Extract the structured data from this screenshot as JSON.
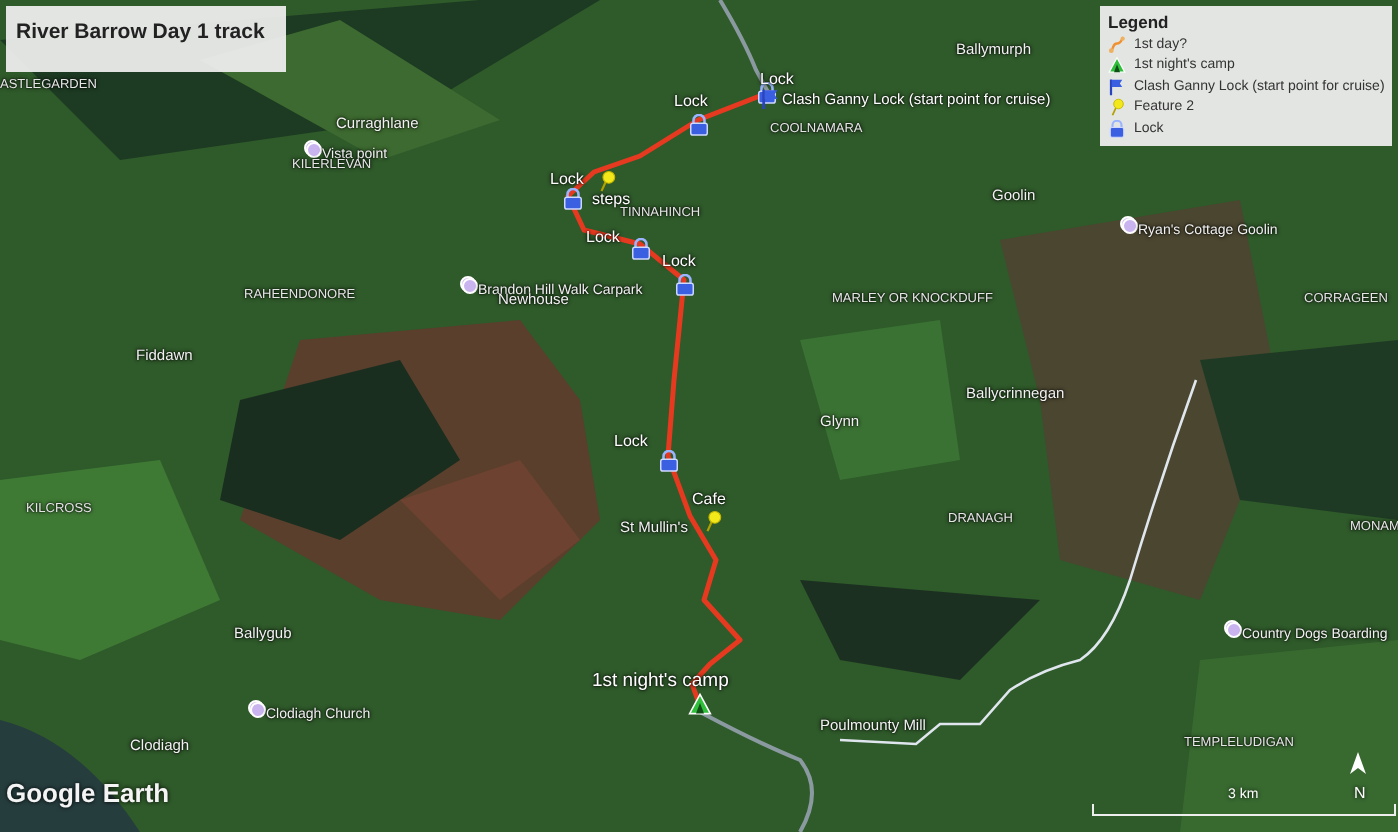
{
  "title": "River Barrow Day 1 track",
  "legend": {
    "heading": "Legend",
    "items": [
      {
        "kind": "route",
        "label": "1st day?"
      },
      {
        "kind": "camp",
        "label": "1st night's camp"
      },
      {
        "kind": "start",
        "label": "Clash Ganny Lock (start point for cruise)"
      },
      {
        "kind": "feature",
        "label": "Feature 2"
      },
      {
        "kind": "lock",
        "label": "Lock"
      }
    ]
  },
  "markers": [
    {
      "kind": "lock",
      "label": "Lock"
    },
    {
      "kind": "lock",
      "label": "Lock"
    },
    {
      "kind": "start",
      "label": "Clash Ganny Lock (start point for cruise)"
    },
    {
      "kind": "feature",
      "label": "steps"
    },
    {
      "kind": "lock",
      "label": "Lock"
    },
    {
      "kind": "lock",
      "label": "Lock"
    },
    {
      "kind": "lock",
      "label": "Lock"
    },
    {
      "kind": "lock",
      "label": "Lock"
    },
    {
      "kind": "feature",
      "label": "Cafe"
    },
    {
      "kind": "camp",
      "label": "1st night's camp"
    }
  ],
  "places": [
    {
      "kind": "area",
      "text": "ASTLEGARDEN"
    },
    {
      "kind": "town",
      "text": "Curraghlane"
    },
    {
      "kind": "poi",
      "text": "Vista point"
    },
    {
      "kind": "area",
      "text": "KILERLEVAN"
    },
    {
      "kind": "area",
      "text": "TINNAHINCH"
    },
    {
      "kind": "area",
      "text": "COOLNAMARA"
    },
    {
      "kind": "town",
      "text": "Ballymurph"
    },
    {
      "kind": "town",
      "text": "Goolin"
    },
    {
      "kind": "poi",
      "text": "Ryan's Cottage Goolin"
    },
    {
      "kind": "poi",
      "text": "Brandon Hill Walk Carpark"
    },
    {
      "kind": "town",
      "text": "Newhouse"
    },
    {
      "kind": "area",
      "text": "RAHEENDONORE"
    },
    {
      "kind": "area",
      "text": "MARLEY OR KNOCKDUFF"
    },
    {
      "kind": "area",
      "text": "CORRAGEEN"
    },
    {
      "kind": "town",
      "text": "Fiddawn"
    },
    {
      "kind": "town",
      "text": "Glynn"
    },
    {
      "kind": "town",
      "text": "Ballycrinnegan"
    },
    {
      "kind": "area",
      "text": "KILCROSS"
    },
    {
      "kind": "town",
      "text": "St Mullin's"
    },
    {
      "kind": "area",
      "text": "DRANAGH"
    },
    {
      "kind": "area",
      "text": "MONAM"
    },
    {
      "kind": "town",
      "text": "Ballygub"
    },
    {
      "kind": "poi",
      "text": "Clodiagh Church"
    },
    {
      "kind": "town",
      "text": "Clodiagh"
    },
    {
      "kind": "town",
      "text": "Poulmounty Mill"
    },
    {
      "kind": "poi",
      "text": "Country Dogs Boarding"
    },
    {
      "kind": "area",
      "text": "TEMPLELUDIGAN"
    }
  ],
  "scale": {
    "label": "3 km"
  },
  "compass": {
    "label": "N"
  },
  "logo": "Google Earth"
}
